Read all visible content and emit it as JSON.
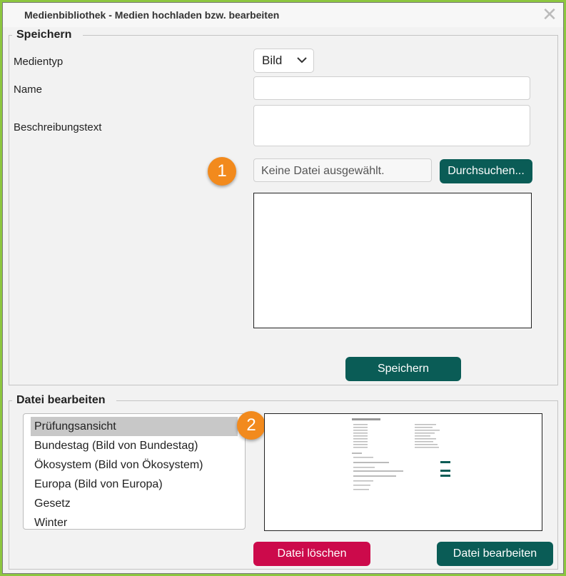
{
  "window": {
    "title": "Medienbibliothek - Medien hochladen bzw. bearbeiten",
    "close_glyph": "✕"
  },
  "save_section": {
    "legend": "Speichern",
    "media_type_label": "Medientyp",
    "media_type_value": "Bild",
    "name_label": "Name",
    "name_value": "",
    "description_label": "Beschreibungstext",
    "description_value": "",
    "file_placeholder": "Keine Datei ausgewählt.",
    "browse_button": "Durchsuchen...",
    "save_button": "Speichern",
    "callout": "1"
  },
  "edit_section": {
    "legend": "Datei bearbeiten",
    "files": [
      {
        "label": "Prüfungsansicht",
        "selected": true
      },
      {
        "label": "Bundestag (Bild von Bundestag)",
        "selected": false
      },
      {
        "label": "Ökosystem (Bild von Ökosystem)",
        "selected": false
      },
      {
        "label": "Europa (Bild von Europa)",
        "selected": false
      },
      {
        "label": "Gesetz",
        "selected": false
      },
      {
        "label": "Winter",
        "selected": false
      }
    ],
    "delete_button": "Datei löschen",
    "edit_button": "Datei bearbeiten",
    "callout": "2"
  },
  "colors": {
    "accent_teal": "#0a5c56",
    "danger_red": "#cc0a4b",
    "callout_orange": "#f28a1d",
    "frame_green": "#8cc63f"
  }
}
